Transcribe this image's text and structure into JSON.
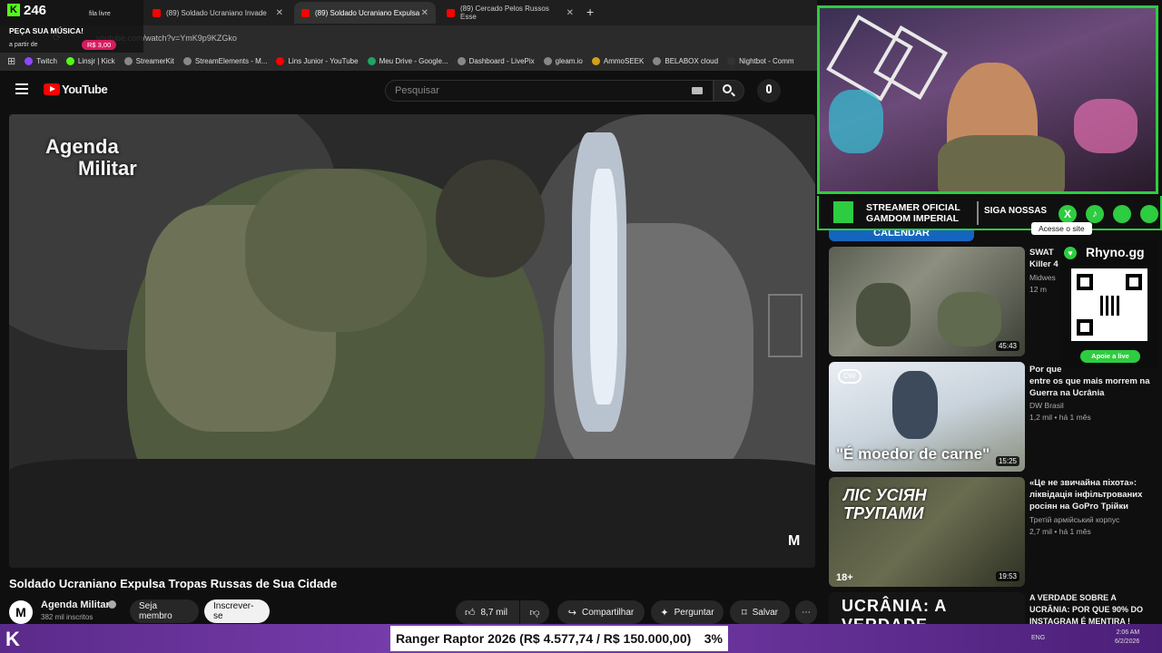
{
  "browser": {
    "tabs": [
      {
        "label": "(89) Soldado Ucraniano Invade"
      },
      {
        "label": "(89) Soldado Ucraniano Expulsa"
      },
      {
        "label": "(89) Cercado Pelos Russos Esse"
      }
    ],
    "url": "youtube.com/watch?v=YmK9p9KZGko",
    "bookmarks": [
      "Twitch",
      "Linsjr | Kick",
      "StreamerKit",
      "StreamElements - M...",
      "Lins Junior - YouTube",
      "Meu Drive - Google...",
      "Dashboard - LivePix",
      "gleam.io",
      "AmmoSEEK",
      "BELABOX cloud",
      "Nightbot - Comm"
    ]
  },
  "overlay_top": {
    "viewer_count": "246",
    "music_label": "PEÇA SUA MÚSICA!",
    "from_label": "a partir de",
    "price": "R$ 3,00",
    "fila_label": "fila livre"
  },
  "youtube": {
    "logo_text": "YouTube",
    "search_placeholder": "Pesquisar",
    "video_watermark_line1": "Agenda",
    "video_watermark_line2": "Militar",
    "video_title": "Soldado Ucraniano Expulsa Tropas Russas de Sua Cidade",
    "channel_name": "Agenda Militar",
    "subscribers": "382 mil inscritos",
    "member_button": "Seja membro",
    "subscribe_button": "Inscrever-se",
    "likes": "8,7 mil",
    "share_button": "Compartilhar",
    "ask_button": "Perguntar",
    "save_button": "Salvar"
  },
  "recommendations": [
    {
      "title": "SWAT",
      "title2": "Killer 4",
      "channel": "Midwes",
      "meta": "12 m",
      "duration": "45:43"
    },
    {
      "title": "Por que",
      "title2": "entre os que mais morrem na Guerra na Ucrânia",
      "channel": "DW Brasil",
      "meta": "1,2 mil • há 1 mês",
      "duration": "15:25",
      "caption": "\"É moedor de carne\""
    },
    {
      "title": "«Це не звичайна піхота»: ліквідація інфільтрованих росіян на GoPro Трійки",
      "channel": "Третій армійський корпус",
      "meta": "2,7 mil • há 1 mês",
      "duration": "19:53",
      "thumb_text": "ЛІС УСІЯН ТРУПАМИ",
      "age": "18+"
    },
    {
      "title": "A VERDADE SOBRE A UCRÂNIA: POR QUE 90% DO INSTAGRAM É MENTIRA !",
      "thumb_text": "UCRÂNIA: A VERDADE"
    }
  ],
  "stream_overlay": {
    "banner_line1": "STREAMER OFICIAL",
    "banner_line2": "GAMDOM IMPERIAL",
    "follow_label": "SIGA NOSSAS",
    "site_label": "Acesse o site",
    "calendar_label": "CALENDAR",
    "brand": "Rhyno.gg",
    "support_label": "Apoie a live"
  },
  "ticker": {
    "text": "Ranger Raptor 2026 (R$ 4.577,74 / R$ 150.000,00)",
    "percent": "3%"
  },
  "taskbar": {
    "time": "2:06 AM",
    "date": "6/2/2026",
    "lang": "ENG"
  }
}
